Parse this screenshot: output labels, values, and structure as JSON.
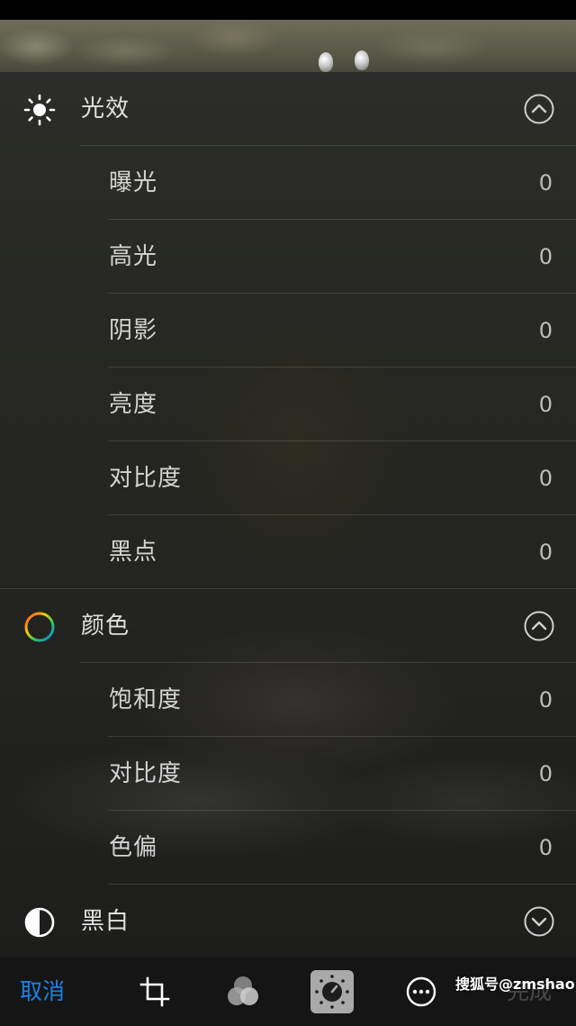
{
  "sections": {
    "light": {
      "title": "光效",
      "icon": "sun-icon",
      "toggle": "chevron-up-circle-icon",
      "items": [
        {
          "label": "曝光",
          "value": "0"
        },
        {
          "label": "高光",
          "value": "0"
        },
        {
          "label": "阴影",
          "value": "0"
        },
        {
          "label": "亮度",
          "value": "0"
        },
        {
          "label": "对比度",
          "value": "0"
        },
        {
          "label": "黑点",
          "value": "0"
        }
      ]
    },
    "color": {
      "title": "颜色",
      "icon": "color-wheel-icon",
      "toggle": "chevron-up-circle-icon",
      "items": [
        {
          "label": "饱和度",
          "value": "0"
        },
        {
          "label": "对比度",
          "value": "0"
        },
        {
          "label": "色偏",
          "value": "0"
        }
      ]
    },
    "bw": {
      "title": "黑白",
      "icon": "half-circle-icon",
      "toggle": "chevron-down-circle-icon"
    }
  },
  "toolbar": {
    "cancel_label": "取消",
    "done_label": "完成",
    "tools": [
      "crop-icon",
      "filters-icon",
      "adjust-dial-icon",
      "more-icon"
    ],
    "active_tool": "adjust-dial-icon"
  },
  "watermark": "搜狐号@zmshao",
  "colors": {
    "accent": "#1a82e8",
    "done_disabled": "#4a4a4a"
  }
}
